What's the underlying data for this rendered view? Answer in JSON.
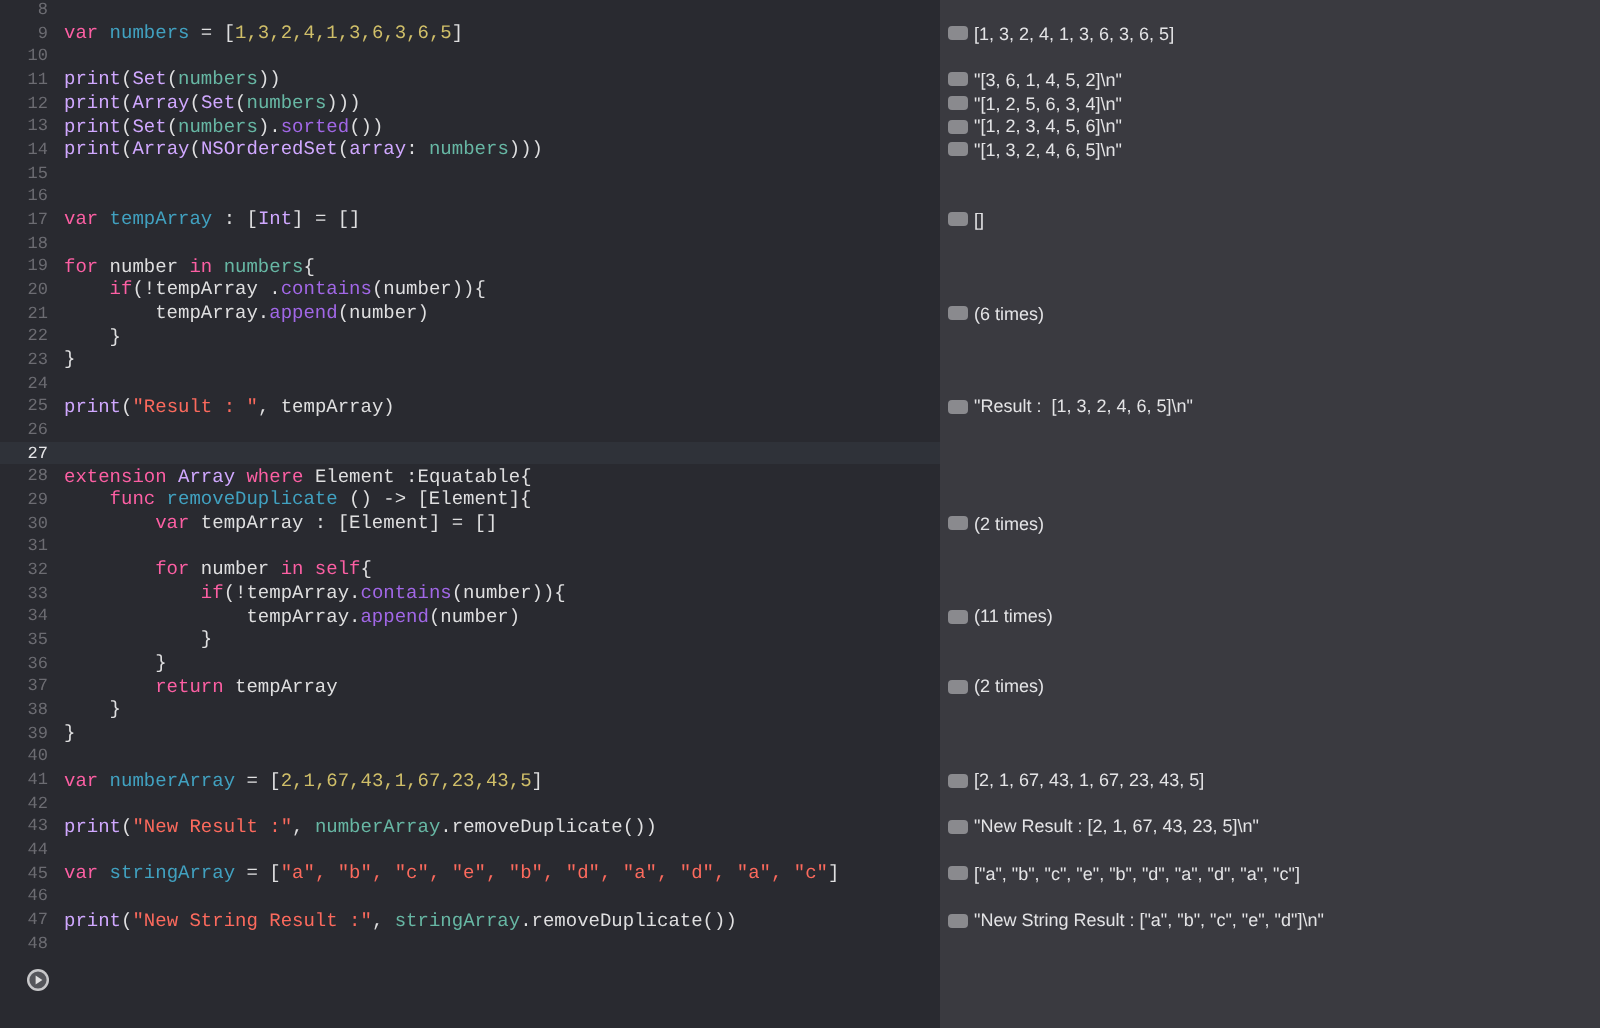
{
  "lines": [
    {
      "number": "8",
      "current": false
    },
    {
      "number": "9",
      "current": false,
      "tokens": [
        {
          "kind": "kw",
          "text": "var"
        },
        {
          "kind": "decl",
          "text": " numbers"
        },
        {
          "kind": "plain",
          "text": " = ["
        },
        {
          "kind": "num",
          "text": "1,3,2,4,1,3,6,3,6,5"
        },
        {
          "kind": "plain",
          "text": "]"
        }
      ],
      "result": "[1, 3, 2, 4, 1, 3, 6, 3, 6, 5]"
    },
    {
      "number": "10",
      "current": false
    },
    {
      "number": "11",
      "current": false,
      "tokens": [
        {
          "kind": "sys",
          "text": "print"
        },
        {
          "kind": "plain",
          "text": "("
        },
        {
          "kind": "sys",
          "text": "Set"
        },
        {
          "kind": "plain",
          "text": "("
        },
        {
          "kind": "ref",
          "text": "numbers"
        },
        {
          "kind": "plain",
          "text": "))"
        }
      ],
      "result": "\"[3, 6, 1, 4, 5, 2]\\n\""
    },
    {
      "number": "12",
      "current": false,
      "tokens": [
        {
          "kind": "sys",
          "text": "print"
        },
        {
          "kind": "plain",
          "text": "("
        },
        {
          "kind": "sys",
          "text": "Array"
        },
        {
          "kind": "plain",
          "text": "("
        },
        {
          "kind": "sys",
          "text": "Set"
        },
        {
          "kind": "plain",
          "text": "("
        },
        {
          "kind": "ref",
          "text": "numbers"
        },
        {
          "kind": "plain",
          "text": ")))"
        }
      ],
      "result": "\"[1, 2, 5, 6, 3, 4]\\n\""
    },
    {
      "number": "13",
      "current": false,
      "tokens": [
        {
          "kind": "sys",
          "text": "print"
        },
        {
          "kind": "plain",
          "text": "("
        },
        {
          "kind": "sys",
          "text": "Set"
        },
        {
          "kind": "plain",
          "text": "("
        },
        {
          "kind": "ref",
          "text": "numbers"
        },
        {
          "kind": "plain",
          "text": ")."
        },
        {
          "kind": "method",
          "text": "sorted"
        },
        {
          "kind": "plain",
          "text": "())"
        }
      ],
      "result": "\"[1, 2, 3, 4, 5, 6]\\n\""
    },
    {
      "number": "14",
      "current": false,
      "tokens": [
        {
          "kind": "sys",
          "text": "print"
        },
        {
          "kind": "plain",
          "text": "("
        },
        {
          "kind": "sys",
          "text": "Array"
        },
        {
          "kind": "plain",
          "text": "("
        },
        {
          "kind": "sys",
          "text": "NSOrderedSet"
        },
        {
          "kind": "plain",
          "text": "("
        },
        {
          "kind": "sys",
          "text": "array"
        },
        {
          "kind": "plain",
          "text": ":"
        },
        {
          "kind": "ref",
          "text": " numbers"
        },
        {
          "kind": "plain",
          "text": ")))"
        }
      ],
      "result": "\"[1, 3, 2, 4, 6, 5]\\n\""
    },
    {
      "number": "15",
      "current": false
    },
    {
      "number": "16",
      "current": false
    },
    {
      "number": "17",
      "current": false,
      "tokens": [
        {
          "kind": "kw",
          "text": "var"
        },
        {
          "kind": "decl",
          "text": " tempArray"
        },
        {
          "kind": "plain",
          "text": " : ["
        },
        {
          "kind": "sys",
          "text": "Int"
        },
        {
          "kind": "plain",
          "text": "] = []"
        }
      ],
      "result": "[]"
    },
    {
      "number": "18",
      "current": false
    },
    {
      "number": "19",
      "current": false,
      "tokens": [
        {
          "kind": "kw",
          "text": "for"
        },
        {
          "kind": "plain",
          "text": " number "
        },
        {
          "kind": "kw",
          "text": "in"
        },
        {
          "kind": "ref",
          "text": " numbers"
        },
        {
          "kind": "plain",
          "text": "{"
        }
      ]
    },
    {
      "number": "20",
      "current": false,
      "tokens": [
        {
          "kind": "kw",
          "text": "    if"
        },
        {
          "kind": "plain",
          "text": "(!tempArray ."
        },
        {
          "kind": "method",
          "text": "contains"
        },
        {
          "kind": "plain",
          "text": "(number)){"
        }
      ]
    },
    {
      "number": "21",
      "current": false,
      "tokens": [
        {
          "kind": "plain",
          "text": "        tempArray."
        },
        {
          "kind": "method",
          "text": "append"
        },
        {
          "kind": "plain",
          "text": "(number)"
        }
      ],
      "result": "(6 times)"
    },
    {
      "number": "22",
      "current": false,
      "tokens": [
        {
          "kind": "plain",
          "text": "    }"
        }
      ]
    },
    {
      "number": "23",
      "current": false,
      "tokens": [
        {
          "kind": "plain",
          "text": "}"
        }
      ]
    },
    {
      "number": "24",
      "current": false
    },
    {
      "number": "25",
      "current": false,
      "tokens": [
        {
          "kind": "sys",
          "text": "print"
        },
        {
          "kind": "plain",
          "text": "("
        },
        {
          "kind": "str",
          "text": "\"Result : \""
        },
        {
          "kind": "plain",
          "text": ", tempArray)"
        }
      ],
      "result": "\"Result :  [1, 3, 2, 4, 6, 5]\\n\""
    },
    {
      "number": "26",
      "current": false
    },
    {
      "number": "27",
      "current": true
    },
    {
      "number": "28",
      "current": false,
      "tokens": [
        {
          "kind": "kw",
          "text": "extension"
        },
        {
          "kind": "sys",
          "text": " Array"
        },
        {
          "kind": "kw",
          "text": " where"
        },
        {
          "kind": "plain",
          "text": " Element :Equatable{"
        }
      ]
    },
    {
      "number": "29",
      "current": false,
      "tokens": [
        {
          "kind": "kw",
          "text": "    func"
        },
        {
          "kind": "decl",
          "text": " removeDuplicate"
        },
        {
          "kind": "plain",
          "text": " () -> [Element]{"
        }
      ]
    },
    {
      "number": "30",
      "current": false,
      "tokens": [
        {
          "kind": "kw",
          "text": "        var"
        },
        {
          "kind": "plain",
          "text": " tempArray : [Element] = []"
        }
      ],
      "result": "(2 times)"
    },
    {
      "number": "31",
      "current": false
    },
    {
      "number": "32",
      "current": false,
      "tokens": [
        {
          "kind": "kw",
          "text": "        for"
        },
        {
          "kind": "plain",
          "text": " number "
        },
        {
          "kind": "kw",
          "text": "in self"
        },
        {
          "kind": "plain",
          "text": "{"
        }
      ]
    },
    {
      "number": "33",
      "current": false,
      "tokens": [
        {
          "kind": "kw",
          "text": "            if"
        },
        {
          "kind": "plain",
          "text": "(!tempArray."
        },
        {
          "kind": "method",
          "text": "contains"
        },
        {
          "kind": "plain",
          "text": "(number)){"
        }
      ]
    },
    {
      "number": "34",
      "current": false,
      "tokens": [
        {
          "kind": "plain",
          "text": "                tempArray."
        },
        {
          "kind": "method",
          "text": "append"
        },
        {
          "kind": "plain",
          "text": "(number)"
        }
      ],
      "result": "(11 times)"
    },
    {
      "number": "35",
      "current": false,
      "tokens": [
        {
          "kind": "plain",
          "text": "            }"
        }
      ]
    },
    {
      "number": "36",
      "current": false,
      "tokens": [
        {
          "kind": "plain",
          "text": "        }"
        }
      ]
    },
    {
      "number": "37",
      "current": false,
      "tokens": [
        {
          "kind": "kw",
          "text": "        return"
        },
        {
          "kind": "plain",
          "text": " tempArray"
        }
      ],
      "result": "(2 times)"
    },
    {
      "number": "38",
      "current": false,
      "tokens": [
        {
          "kind": "plain",
          "text": "    }"
        }
      ]
    },
    {
      "number": "39",
      "current": false,
      "tokens": [
        {
          "kind": "plain",
          "text": "}"
        }
      ]
    },
    {
      "number": "40",
      "current": false
    },
    {
      "number": "41",
      "current": false,
      "tokens": [
        {
          "kind": "kw",
          "text": "var"
        },
        {
          "kind": "decl",
          "text": " numberArray"
        },
        {
          "kind": "plain",
          "text": " = ["
        },
        {
          "kind": "num",
          "text": "2,1,67,43,1,67,23,43,5"
        },
        {
          "kind": "plain",
          "text": "]"
        }
      ],
      "result": "[2, 1, 67, 43, 1, 67, 23, 43, 5]"
    },
    {
      "number": "42",
      "current": false
    },
    {
      "number": "43",
      "current": false,
      "tokens": [
        {
          "kind": "sys",
          "text": "print"
        },
        {
          "kind": "plain",
          "text": "("
        },
        {
          "kind": "str",
          "text": "\"New Result :\""
        },
        {
          "kind": "plain",
          "text": ","
        },
        {
          "kind": "ref",
          "text": " numberArray"
        },
        {
          "kind": "plain",
          "text": ".removeDuplicate())"
        }
      ],
      "result": "\"New Result : [2, 1, 67, 43, 23, 5]\\n\""
    },
    {
      "number": "44",
      "current": false
    },
    {
      "number": "45",
      "current": false,
      "tokens": [
        {
          "kind": "kw",
          "text": "var"
        },
        {
          "kind": "decl",
          "text": " stringArray"
        },
        {
          "kind": "plain",
          "text": " = ["
        },
        {
          "kind": "str",
          "text": "\"a\", \"b\", \"c\", \"e\", \"b\", \"d\", \"a\", \"d\", \"a\", \"c\""
        },
        {
          "kind": "plain",
          "text": "]"
        }
      ],
      "result": "[\"a\", \"b\", \"c\", \"e\", \"b\", \"d\", \"a\", \"d\", \"a\", \"c\"]"
    },
    {
      "number": "46",
      "current": false
    },
    {
      "number": "47",
      "current": false,
      "tokens": [
        {
          "kind": "sys",
          "text": "print"
        },
        {
          "kind": "plain",
          "text": "("
        },
        {
          "kind": "str",
          "text": "\"New String Result :\""
        },
        {
          "kind": "plain",
          "text": ","
        },
        {
          "kind": "ref",
          "text": " stringArray"
        },
        {
          "kind": "plain",
          "text": ".removeDuplicate())"
        }
      ],
      "result": "\"New String Result : [\"a\", \"b\", \"c\", \"e\", \"d\"]\\n\""
    },
    {
      "number": "48",
      "current": false
    }
  ]
}
